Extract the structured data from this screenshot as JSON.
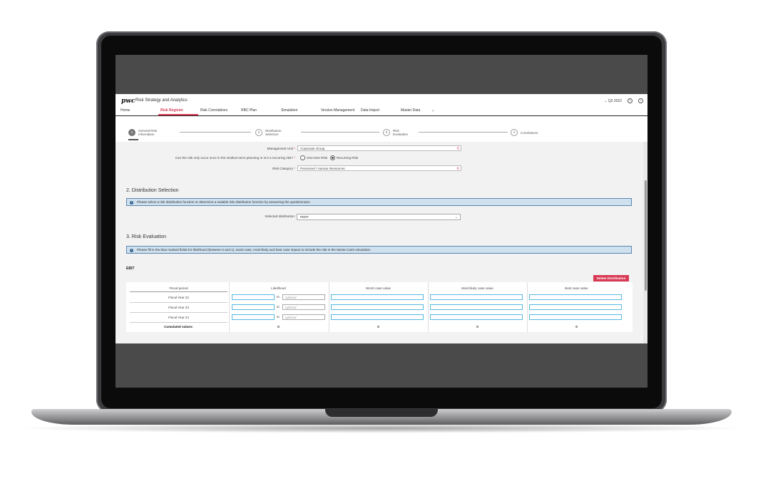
{
  "app": {
    "logo": "pwc",
    "title": "Risk Strategy and Analytics",
    "period": "Q2 2022",
    "help_icon": "?",
    "info_icon": "i"
  },
  "nav": [
    "Home",
    "Risk Register",
    "Risk Correlations",
    "RBC Plan",
    "Simulation",
    "Version Management",
    "Data Import",
    "Master Data"
  ],
  "nav_active": "Risk Register",
  "steps": [
    {
      "num": "1",
      "label": "General Risk Information"
    },
    {
      "num": "2",
      "label": "Distribution Selection"
    },
    {
      "num": "3",
      "label": "Risk Evaluation"
    },
    {
      "num": "4",
      "label": "Correlations"
    }
  ],
  "form": {
    "management_unit_label": "Management Unit",
    "management_unit_value": "Corporate Group",
    "recurring_label": "Can the risk only occur once in the medium-term planning or is it a recurring risk?",
    "one_time": "One-time Risk",
    "recurring": "Recurring Risk",
    "risk_category_label": "Risk Category",
    "risk_category_value": "Personnel / Human Resources",
    "required_mark": "*"
  },
  "distribution": {
    "heading": "2. Distribution Selection",
    "info": "Please select a risk distribution function or determine a suitable risk distribution function by answering the questionnaire.",
    "selected_label": "Selected distribution:",
    "selected_value": "PERT"
  },
  "evaluation": {
    "heading": "3. Risk Evaluation",
    "info": "Please fill in the blue marked fields for likelihood (between 0 and 1), worst case, most likely and best case impact to include the risk in the Monte Carlo simulation.",
    "section": "EBIT",
    "delete_button": "Delete Distribution",
    "columns": [
      "Fiscal period",
      "Likelihood",
      "Worst case value",
      "Most likely case value",
      "Best case value"
    ],
    "rows": [
      "Fiscal Year 22",
      "Fiscal Year 23",
      "Fiscal Year 24"
    ],
    "to_label": "to",
    "optional_placeholder": "optional",
    "cumulated_label": "Cumulated values:",
    "cumulated": [
      "0",
      "0",
      "0",
      "0"
    ]
  },
  "colors": {
    "accent": "#d93954",
    "info_bg": "#cfe0ee",
    "input_border": "#55b8e0"
  }
}
